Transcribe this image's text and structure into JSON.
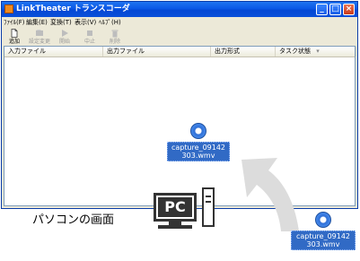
{
  "window": {
    "title": "LinkTheater トランスコーダ",
    "controls": {
      "minimize": "_",
      "maximize": "□",
      "close": "×"
    }
  },
  "menu": [
    "ﾌｧｲﾙ(F)",
    "編集(E)",
    "変換(T)",
    "表示(V)",
    "ﾍﾙﾌﾟ(H)"
  ],
  "toolbar": [
    {
      "label": "追加",
      "icon": "add-file-icon",
      "enabled": true
    },
    {
      "label": "設定変更",
      "icon": "settings-icon",
      "enabled": false
    },
    {
      "label": "開始",
      "icon": "play-icon",
      "enabled": false
    },
    {
      "label": "中止",
      "icon": "stop-icon",
      "enabled": false
    },
    {
      "label": "削除",
      "icon": "trash-icon",
      "enabled": false
    }
  ],
  "columns": {
    "input": "入力ファイル",
    "output": "出力ファイル",
    "format": "出力形式",
    "status": "タスク状態",
    "status_sort": "▾"
  },
  "dragged_file": {
    "line1": "capture_09142",
    "line2": "303.wmv"
  },
  "desktop_file": {
    "line1": "capture_09142",
    "line2": "303.wmv"
  },
  "pc_caption": "パソコンの画面",
  "pc_label": "PC",
  "colors": {
    "titlebar": "#0b58e6",
    "selection": "#316ac5",
    "arrow": "#dcdcdc"
  }
}
